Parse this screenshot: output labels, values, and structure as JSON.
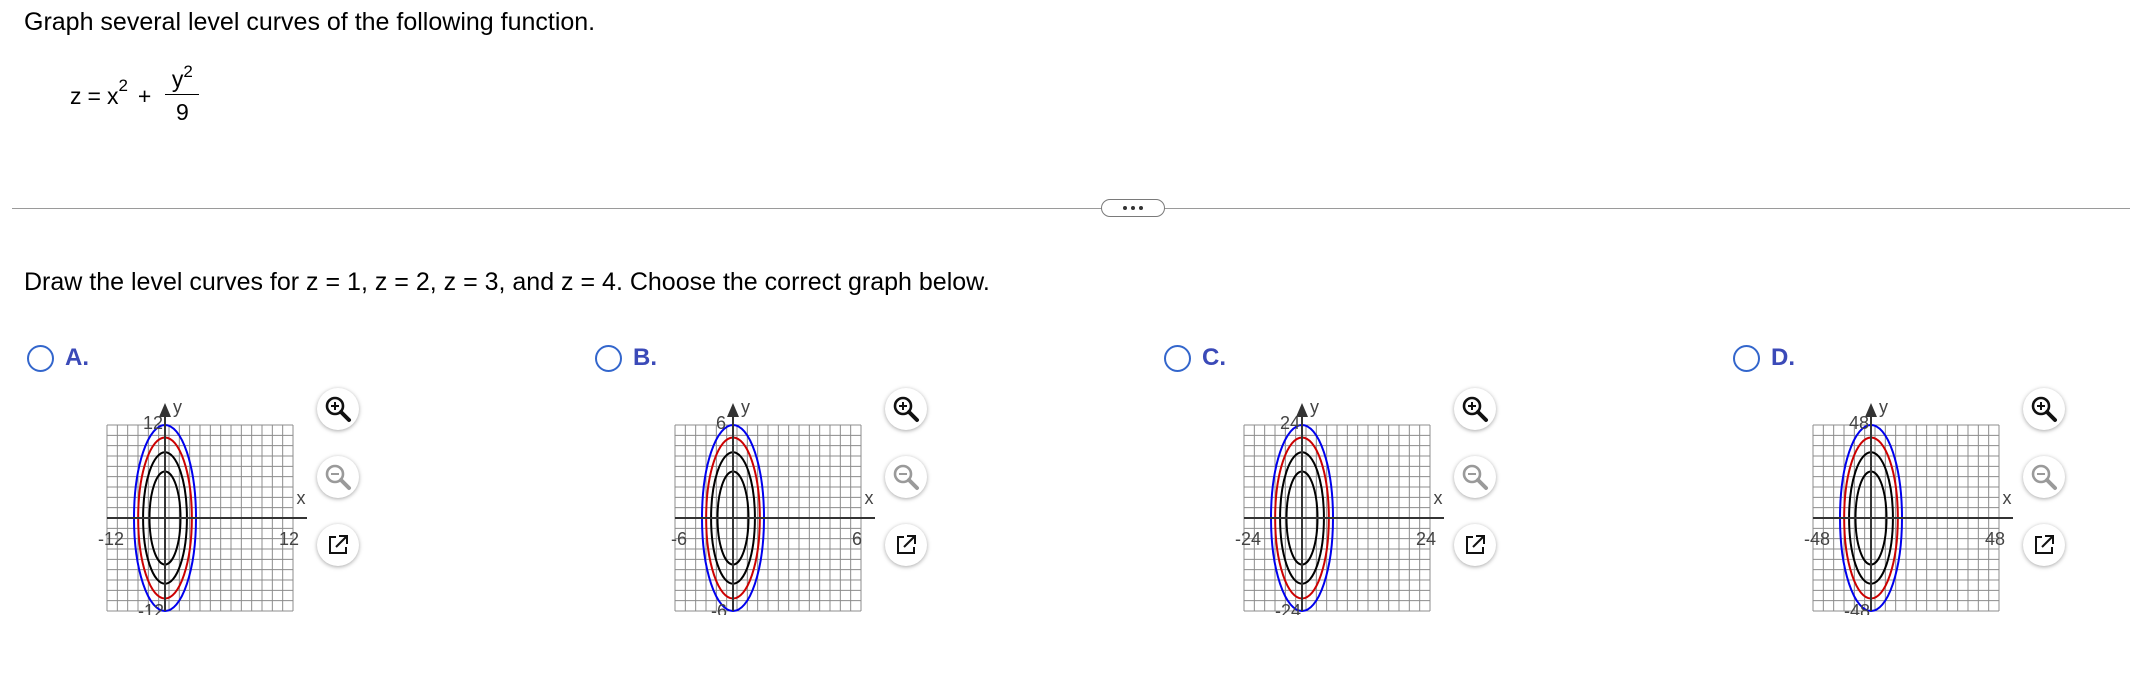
{
  "prompt": "Graph several level curves of the following function.",
  "formula": {
    "lhs": "z",
    "equals": "=",
    "x_term": "x",
    "x_exp": "2",
    "plus": "+",
    "y_term": "y",
    "y_exp": "2",
    "denominator": "9"
  },
  "instruction": "Draw the level curves for z = 1, z = 2, z = 3, and z = 4. Choose the correct graph below.",
  "options": [
    {
      "letter": "A.",
      "tick_neg": "-12",
      "tick_pos": "12",
      "y_axis_label": "y",
      "x_axis_label": "x"
    },
    {
      "letter": "B.",
      "tick_neg": "-6",
      "tick_pos": "6",
      "y_axis_label": "y",
      "x_axis_label": "x"
    },
    {
      "letter": "C.",
      "tick_neg": "-24",
      "tick_pos": "24",
      "y_axis_label": "y",
      "x_axis_label": "x"
    },
    {
      "letter": "D.",
      "tick_neg": "-48",
      "tick_pos": "48",
      "y_axis_label": "y",
      "x_axis_label": "x"
    }
  ],
  "icons": {
    "zoom_in": "zoom-in-icon",
    "zoom_out": "zoom-out-icon",
    "popout": "external-link-icon"
  },
  "colors": {
    "radio_border": "#3366cc",
    "option_letter": "#3b4ab8",
    "curve_blue": "#0000ee",
    "curve_red": "#cc0000",
    "curve_black": "#000000",
    "grid": "#8c8c8c"
  }
}
